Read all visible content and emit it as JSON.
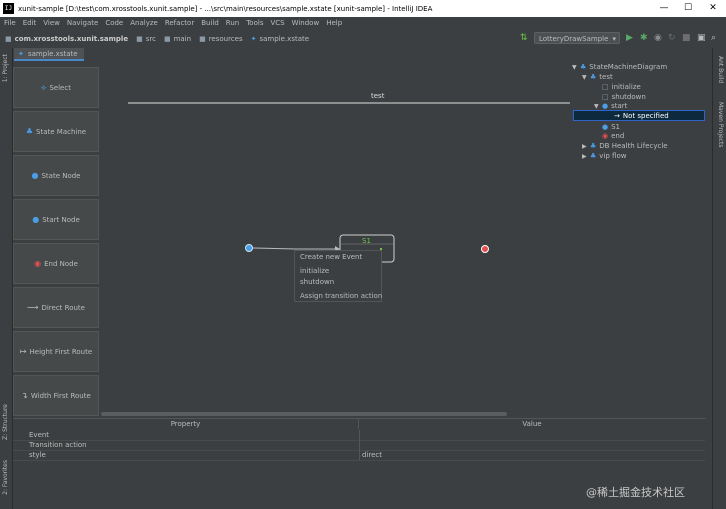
{
  "window": {
    "title": "xunit-sample [D:\\test\\com.xrosstools.xunit.sample] - ...\\src\\main\\resources\\sample.xstate [xunit-sample] - IntelliJ IDEA",
    "logo": "IJ",
    "minimize": "—",
    "maximize": "☐",
    "close": "✕"
  },
  "menu": [
    "File",
    "Edit",
    "View",
    "Navigate",
    "Code",
    "Analyze",
    "Refactor",
    "Build",
    "Run",
    "Tools",
    "VCS",
    "Window",
    "Help"
  ],
  "breadcrumbs": [
    {
      "label": "com.xrosstools.xunit.sample",
      "icon": "folder-icon"
    },
    {
      "label": "src",
      "icon": "folder-icon"
    },
    {
      "label": "main",
      "icon": "folder-icon"
    },
    {
      "label": "resources",
      "icon": "folder-icon"
    },
    {
      "label": "sample.xstate",
      "icon": "state-file-icon"
    }
  ],
  "toolbar": {
    "run_config": "LotteryDrawSample"
  },
  "editor_tab": {
    "label": "sample.xstate"
  },
  "left_strip": {
    "project": "1: Project",
    "structure": "Z: Structure",
    "favorites": "2: Favorites"
  },
  "right_strip": {
    "ant": "Ant Build",
    "maven": "Maven Projects"
  },
  "palette": [
    {
      "label": "Select",
      "icon": "select-icon"
    },
    {
      "label": "State Machine",
      "icon": "state-machine-icon"
    },
    {
      "label": "State Node",
      "icon": "state-node-icon"
    },
    {
      "label": "Start Node",
      "icon": "start-node-icon"
    },
    {
      "label": "End Node",
      "icon": "end-node-icon"
    },
    {
      "label": "Direct Route",
      "icon": "direct-route-icon"
    },
    {
      "label": "Height First Route",
      "icon": "height-first-route-icon"
    },
    {
      "label": "Width First Route",
      "icon": "width-first-route-icon"
    }
  ],
  "diagram": {
    "machine_name": "test",
    "state_label": "S1"
  },
  "context_menu": [
    "Create new Event",
    "initialize",
    "shutdown",
    "Assign transition action"
  ],
  "tree": {
    "root": "StateMachineDiagram",
    "machine": "test",
    "events": [
      "initialize",
      "shutdown"
    ],
    "start": "start",
    "start_child": "Not specified",
    "s1": "S1",
    "end": "end",
    "other_machines": [
      "DB Health Lifecycle",
      "vip flow"
    ]
  },
  "properties": {
    "header_property": "Property",
    "header_value": "Value",
    "rows": [
      {
        "name": "Event",
        "value": ""
      },
      {
        "name": "Transition action",
        "value": ""
      },
      {
        "name": "style",
        "value": "direct"
      }
    ]
  },
  "watermark": "@稀土掘金技术社区",
  "colors": {
    "background": "#3c3f41",
    "accent": "#4a88c7",
    "state_label": "#6cc644",
    "end_node": "#e05050",
    "start_node": "#4a9ee8"
  }
}
